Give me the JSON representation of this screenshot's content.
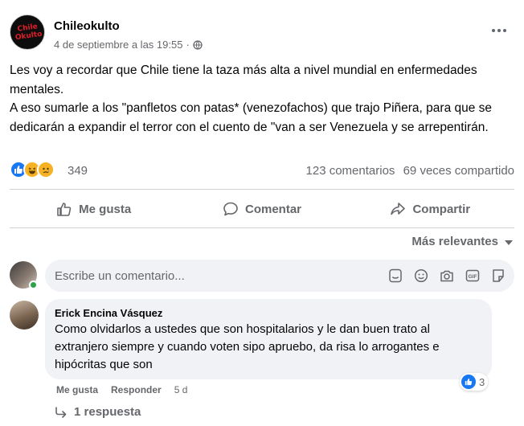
{
  "post": {
    "page_name": "Chileokulto",
    "avatar_logo_text": "Chile Okulto",
    "timestamp": "4 de septiembre a las 19:55",
    "separator": "·",
    "paragraphs": [
      "Les voy a recordar que Chile tiene la taza más alta a nivel mundial en enfermedades mentales.",
      "A eso sumarle a los \"panfletos con patas* (venezofachos) que trajo Piñera, para que se dedicarán a expandir el terror con el cuento de \"van a ser Venezuela y se arrepentirán."
    ]
  },
  "stats": {
    "reactions_count": "349",
    "comments": "123 comentarios",
    "shares": "69 veces compartido"
  },
  "actions": {
    "like": "Me gusta",
    "comment": "Comentar",
    "share": "Compartir"
  },
  "sort": {
    "label": "Más relevantes"
  },
  "composer": {
    "placeholder": "Escribe un comentario..."
  },
  "comment": {
    "author": "Erick Encina Vásquez",
    "text": "Como olvidarlos a ustedes que son hospitalarios y le dan buen trato al extranjero siempre y cuando voten sipo apruebo, da risa lo arrogantes e hipócritas que son",
    "reaction_count": "3",
    "like_label": "Me gusta",
    "reply_label": "Responder",
    "age": "5 d",
    "replies": "1 respuesta"
  },
  "colors": {
    "like_blue": "#1877f2",
    "emoji_yellow": "#f7b125",
    "secondary_text": "#65676b",
    "input_bg": "#f0f2f5",
    "logo_red": "#e11d2a",
    "online_green": "#31a24c"
  },
  "icons": {
    "reactions": [
      "like-icon",
      "haha-icon",
      "sad-icon"
    ],
    "composer": [
      "sticker-gallery-icon",
      "emoji-icon",
      "camera-icon",
      "gif-icon",
      "sticker-icon"
    ]
  }
}
